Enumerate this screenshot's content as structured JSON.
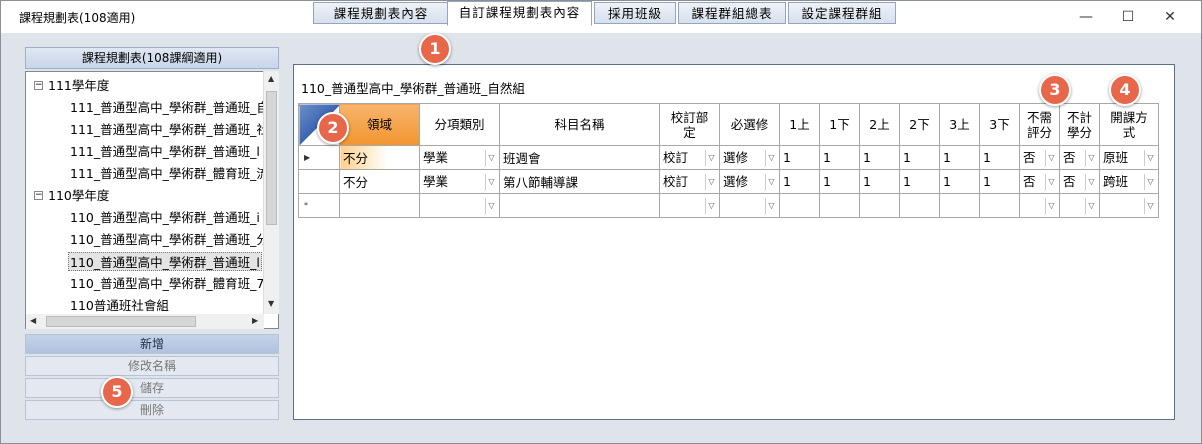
{
  "window": {
    "title": "課程規劃表(108適用)",
    "minimize": "—",
    "maximize": "☐",
    "close": "✕"
  },
  "sidebar": {
    "header": "課程規劃表(108課綱適用)",
    "tree": [
      {
        "label": "111學年度",
        "toggle": "⊟"
      },
      {
        "label": "111_普通型高中_學術群_普通班_自"
      },
      {
        "label": "111_普通型高中_學術群_普通班_社"
      },
      {
        "label": "111_普通型高中_學術群_普通班_l"
      },
      {
        "label": "111_普通型高中_學術群_體育班_流"
      },
      {
        "label": "110學年度",
        "toggle": "⊟"
      },
      {
        "label": "110_普通型高中_學術群_普通班_i"
      },
      {
        "label": "110_普通型高中_學術群_普通班_分"
      },
      {
        "label": "110_普通型高中_學術群_普通班_l"
      },
      {
        "label": "110_普通型高中_學術群_體育班_7"
      },
      {
        "label": "110普通班社會組"
      }
    ],
    "buttons": {
      "add": "新增",
      "rename": "修改名稱",
      "save": "儲存",
      "delete": "刪除"
    }
  },
  "tabs": [
    "課程規劃表內容",
    "自訂課程規劃表內容",
    "採用班級",
    "課程群組總表",
    "設定課程群組"
  ],
  "path": "110_普通型高中_學術群_普通班_自然組",
  "grid": {
    "headers": [
      "領域",
      "分項類別",
      "科目名稱",
      "校訂部定",
      "必選修",
      "1上",
      "1下",
      "2上",
      "2下",
      "3上",
      "3下",
      "不需評分",
      "不計學分",
      "開課方式"
    ],
    "header_lines": [
      [
        "領域"
      ],
      [
        "分項類別"
      ],
      [
        "科目名稱"
      ],
      [
        "校訂部",
        "定"
      ],
      [
        "必選修"
      ],
      [
        "1上"
      ],
      [
        "1下"
      ],
      [
        "2上"
      ],
      [
        "2下"
      ],
      [
        "3上"
      ],
      [
        "3下"
      ],
      [
        "不需",
        "評分"
      ],
      [
        "不計",
        "學分"
      ],
      [
        "開課方",
        "式"
      ]
    ],
    "rows": [
      {
        "marker": "▶",
        "cells": [
          "不分",
          "學業",
          "班週會",
          "校訂",
          "選修",
          "1",
          "1",
          "1",
          "1",
          "1",
          "1",
          "否",
          "否",
          "原班"
        ]
      },
      {
        "marker": "",
        "cells": [
          "不分",
          "學業",
          "第八節輔導課",
          "校訂",
          "選修",
          "1",
          "1",
          "1",
          "1",
          "1",
          "1",
          "否",
          "否",
          "跨班"
        ]
      },
      {
        "marker": "*",
        "cells": [
          "",
          "",
          "",
          "",
          "",
          "",
          "",
          "",
          "",
          "",
          "",
          "",
          "",
          ""
        ]
      }
    ]
  },
  "badges": [
    "1",
    "2",
    "3",
    "4",
    "5"
  ],
  "accent": "#e8664a"
}
